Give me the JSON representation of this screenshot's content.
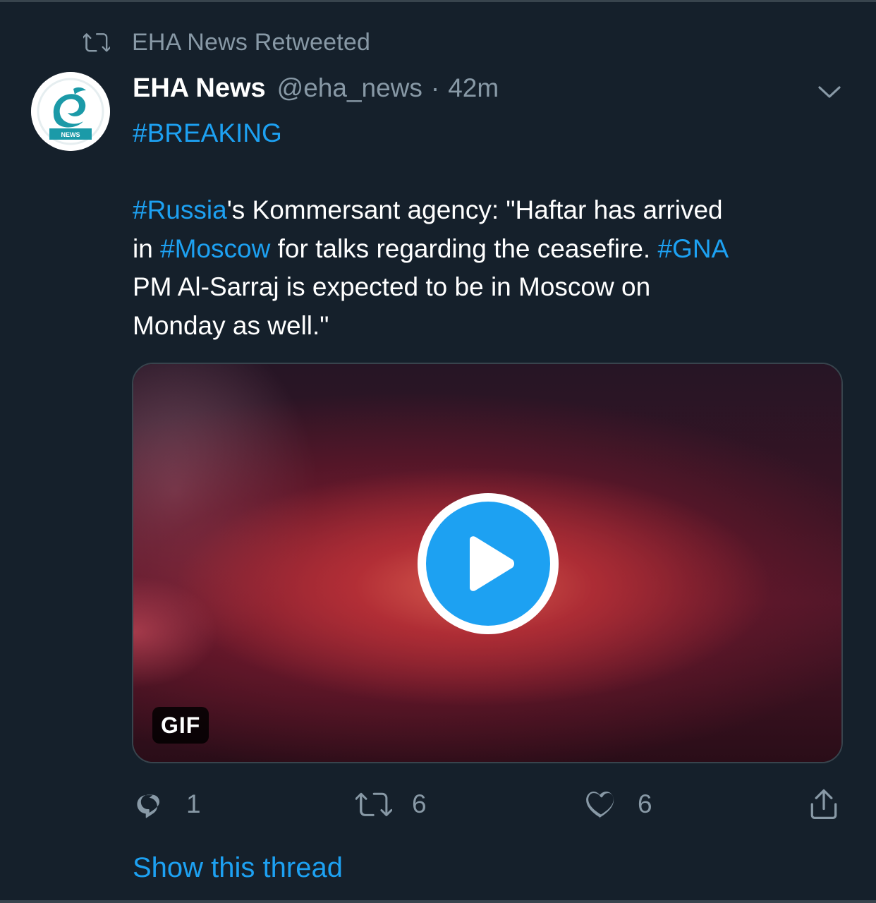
{
  "social_context": {
    "icon": "retweet-icon",
    "text": "EHA News Retweeted"
  },
  "tweet": {
    "avatar": {
      "icon": "eha-news-logo",
      "badge_text": "NEWS"
    },
    "author": {
      "display_name": "EHA News",
      "handle": "@eha_news",
      "separator": "·",
      "time": "42m"
    },
    "menu_icon": "chevron-down-icon",
    "text": {
      "line1_hashtag": "#BREAKING",
      "line2_hashtag": "#Russia",
      "line2_text": "'s Kommersant agency: \"Haftar has arrived",
      "line3_prefix": "in ",
      "line3_hashtag": "#Moscow",
      "line3_text": " for talks regarding the ceasefire. ",
      "line3_hashtag2": "#GNA",
      "line4_text": "PM Al-Sarraj is expected to be in Moscow on",
      "line5_text": "Monday as well.\""
    },
    "media": {
      "type_label": "GIF",
      "play_icon": "play-icon"
    },
    "actions": {
      "reply": {
        "icon": "reply-icon",
        "count": "1"
      },
      "retweet": {
        "icon": "retweet-icon",
        "count": "6"
      },
      "like": {
        "icon": "heart-icon",
        "count": "6"
      },
      "share": {
        "icon": "share-icon"
      }
    },
    "show_thread_label": "Show this thread"
  },
  "colors": {
    "background": "#15202b",
    "divider": "#38444d",
    "secondary_text": "#8899a6",
    "accent": "#1da1f2"
  }
}
